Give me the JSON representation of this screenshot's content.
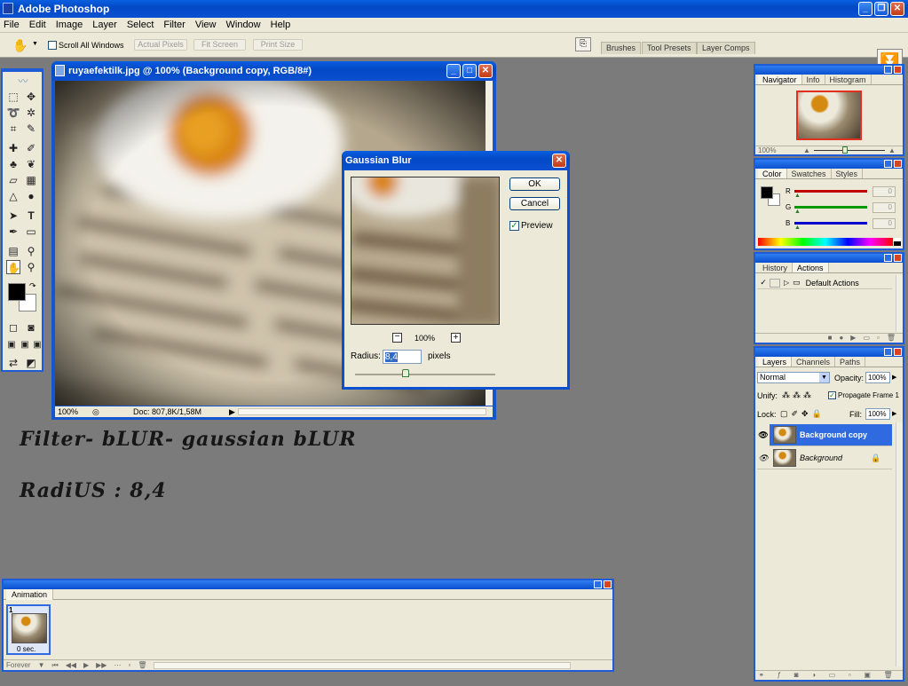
{
  "app": {
    "title": "Adobe Photoshop"
  },
  "menu": [
    "File",
    "Edit",
    "Image",
    "Layer",
    "Select",
    "Filter",
    "View",
    "Window",
    "Help"
  ],
  "options_bar": {
    "scroll_all_label": "Scroll All Windows",
    "actual_pixels": "Actual Pixels",
    "fit_screen": "Fit Screen",
    "print_size": "Print Size",
    "well_tabs": [
      "Brushes",
      "Tool Presets",
      "Layer Comps"
    ]
  },
  "document": {
    "title": "ruyaefektilk.jpg @ 100% (Background copy, RGB/8#)",
    "zoom": "100%",
    "doc_info": "Doc: 807,8K/1,58M"
  },
  "gaussian_blur": {
    "title": "Gaussian Blur",
    "ok": "OK",
    "cancel": "Cancel",
    "preview_label": "Preview",
    "preview_checked": true,
    "zoom": "100%",
    "radius_label": "Radius:",
    "radius_value": "8,4",
    "radius_unit": "pixels"
  },
  "annotation": {
    "line1": "Filter- bLUR- gaussian bLUR",
    "line2": "RadiUS : 8,4"
  },
  "navigator": {
    "tabs": [
      "Navigator",
      "Info",
      "Histogram"
    ],
    "zoom": "100%"
  },
  "color_panel": {
    "tabs": [
      "Color",
      "Swatches",
      "Styles"
    ],
    "channels": [
      {
        "label": "R",
        "value": "0",
        "color": "#cc0000"
      },
      {
        "label": "G",
        "value": "0",
        "color": "#009900"
      },
      {
        "label": "B",
        "value": "0",
        "color": "#0000cc"
      }
    ]
  },
  "actions_panel": {
    "tabs": [
      "History",
      "Actions"
    ],
    "item": "Default Actions"
  },
  "layers_panel": {
    "tabs": [
      "Layers",
      "Channels",
      "Paths"
    ],
    "blend_mode": "Normal",
    "opacity_label": "Opacity:",
    "opacity": "100%",
    "unify_label": "Unify:",
    "propagate_label": "Propagate Frame 1",
    "lock_label": "Lock:",
    "fill_label": "Fill:",
    "fill": "100%",
    "layers": [
      {
        "name": "Background copy",
        "active": true
      },
      {
        "name": "Background",
        "active": false
      }
    ]
  },
  "animation_panel": {
    "title": "Animation",
    "frame_number": "1",
    "frame_delay": "0 sec.",
    "loop": "Forever"
  }
}
